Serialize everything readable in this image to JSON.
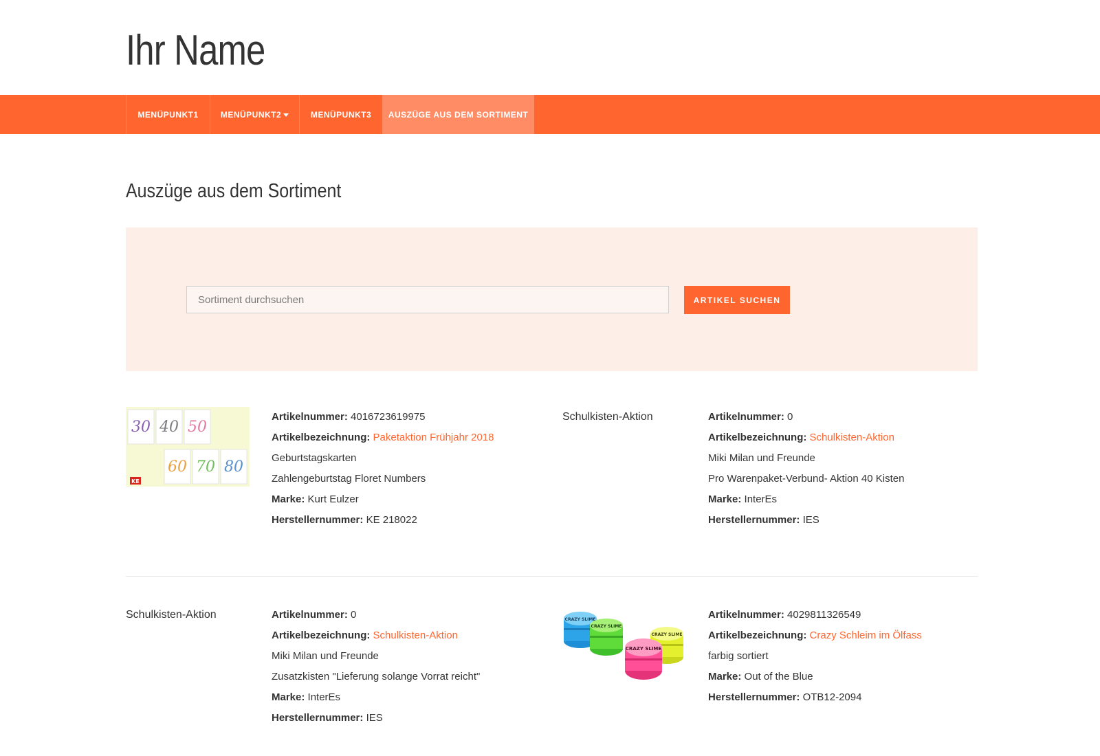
{
  "site": {
    "title": "Ihr Name"
  },
  "nav": {
    "items": [
      {
        "label": "MENÜPUNKT1"
      },
      {
        "label": "MENÜPUNKT2"
      },
      {
        "label": "MENÜPUNKT3"
      },
      {
        "label": "AUSZÜGE AUS DEM SORTIMENT"
      }
    ]
  },
  "page": {
    "heading": "Auszüge aus dem Sortiment"
  },
  "search": {
    "placeholder": "Sortiment durchsuchen",
    "button_label": "ARTIKEL SUCHEN"
  },
  "colors": {
    "accent": "#ff652f",
    "panel_bg": "#fdeee8",
    "active_nav": "#ff8c64"
  },
  "labels": {
    "artikelnummer": "Artikelnummer:",
    "artikelbezeichnung": "Artikelbezeichnung:",
    "marke": "Marke:",
    "herstellernummer": "Herstellernummer:"
  },
  "products": [
    {
      "image_alt": "",
      "artikelnummer": "4016723619975",
      "bezeichnung": "Paketaktion Frühjahr 2018",
      "details": [
        "Geburtstagskarten",
        "Zahlengeburtstag Floret Numbers"
      ],
      "marke": "Kurt Eulzer",
      "herstellernummer": "KE 218022"
    },
    {
      "image_alt": "Schulkisten-Aktion",
      "artikelnummer": "0",
      "bezeichnung": "Schulkisten-Aktion",
      "details": [
        "Miki Milan und Freunde",
        "Pro Warenpaket-Verbund- Aktion 40 Kisten"
      ],
      "marke": "InterEs",
      "herstellernummer": "IES"
    },
    {
      "image_alt": "Schulkisten-Aktion",
      "artikelnummer": "0",
      "bezeichnung": "Schulkisten-Aktion",
      "details": [
        "Miki Milan und Freunde",
        "Zusatzkisten \"Lieferung solange Vorrat reicht\""
      ],
      "marke": "InterEs",
      "herstellernummer": "IES"
    },
    {
      "image_alt": "",
      "artikelnummer": "4029811326549",
      "bezeichnung": "Crazy Schleim im Ölfass",
      "details": [
        "farbig sortiert"
      ],
      "marke": "Out of the Blue",
      "herstellernummer": "OTB12-2094"
    }
  ],
  "images": {
    "cards_numbers": [
      "30",
      "40",
      "50",
      "60",
      "70",
      "80"
    ],
    "cards_logo": "KE",
    "slime_label": "CRAZY SLIME"
  }
}
